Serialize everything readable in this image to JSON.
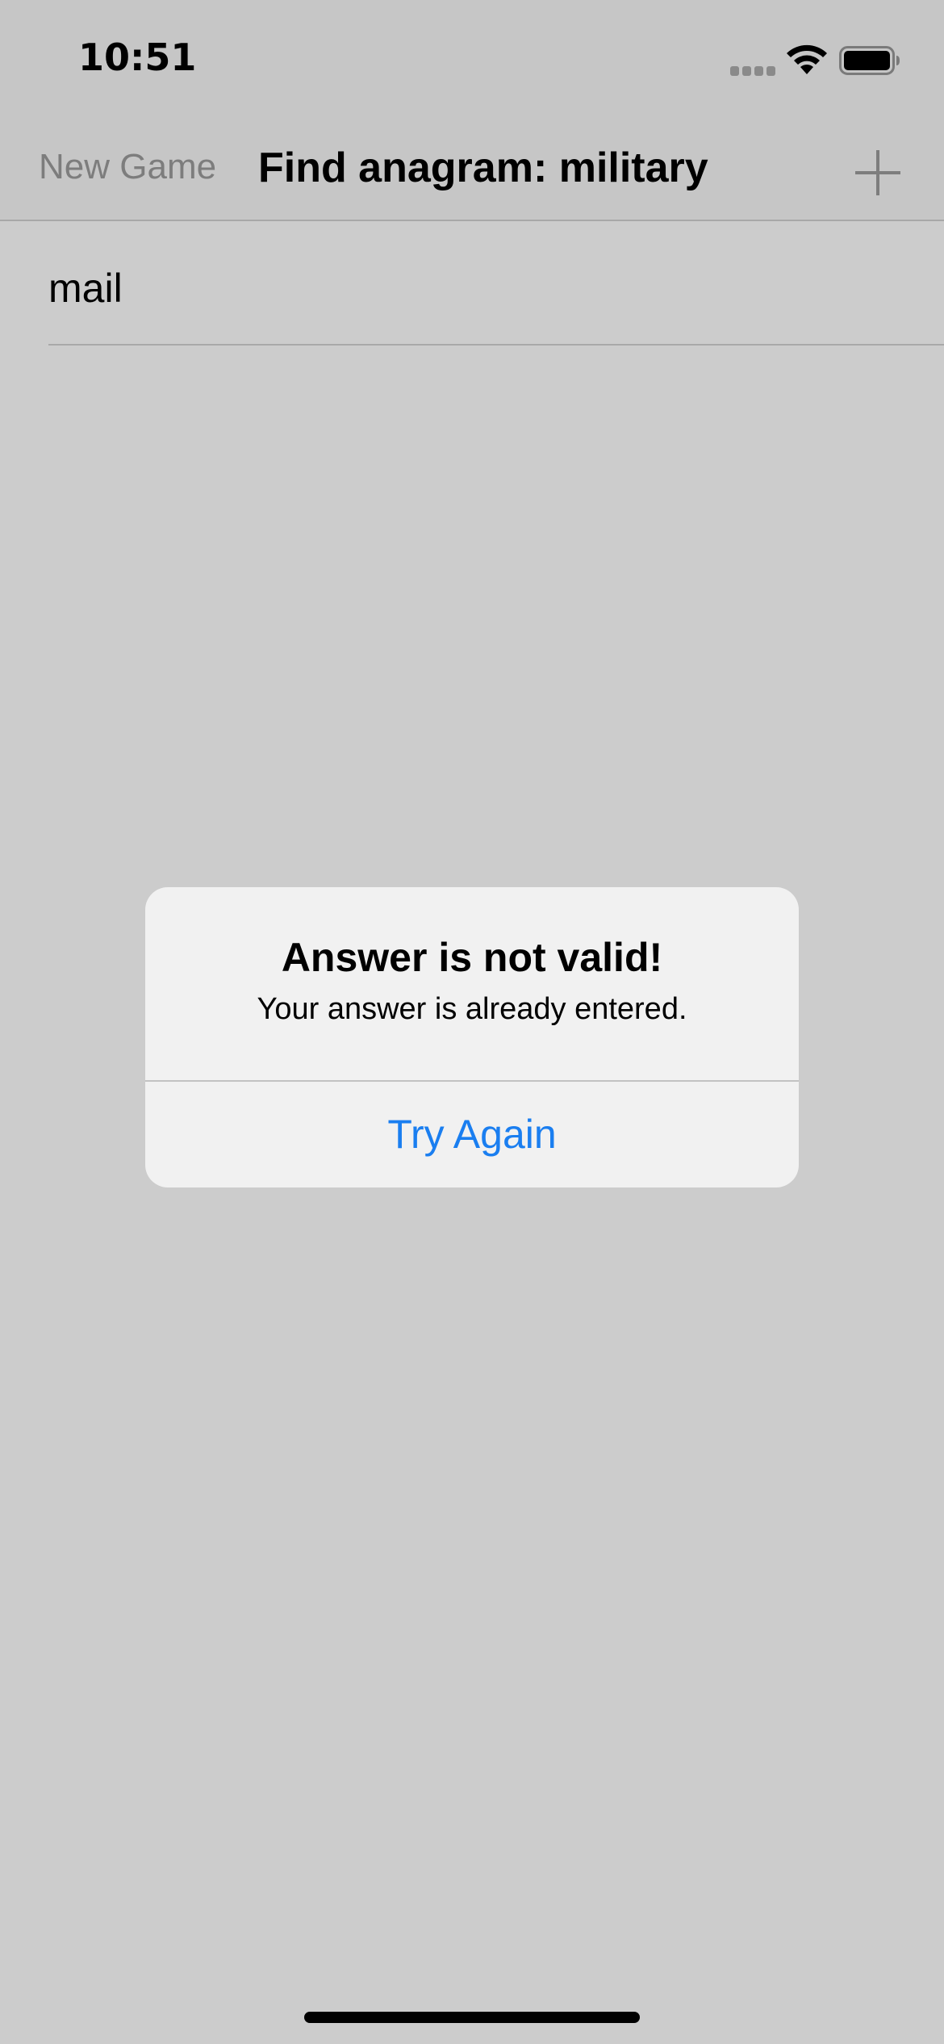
{
  "status_bar": {
    "time": "10:51",
    "signal_icon": "cellular-signal-icon",
    "wifi_icon": "wifi-icon",
    "battery_icon": "battery-icon"
  },
  "nav_bar": {
    "left_button": "New Game",
    "title": "Find anagram: military",
    "right_icon": "plus-icon"
  },
  "list": {
    "items": [
      {
        "text": "mail"
      }
    ]
  },
  "alert": {
    "title": "Answer is not valid!",
    "message": "Your answer is already entered.",
    "button": "Try Again"
  },
  "colors": {
    "dimmed_background": "#cccccc",
    "alert_background": "#f1f1f1",
    "accent": "#1a7ef0",
    "disabled_text": "#7d7d7d"
  }
}
